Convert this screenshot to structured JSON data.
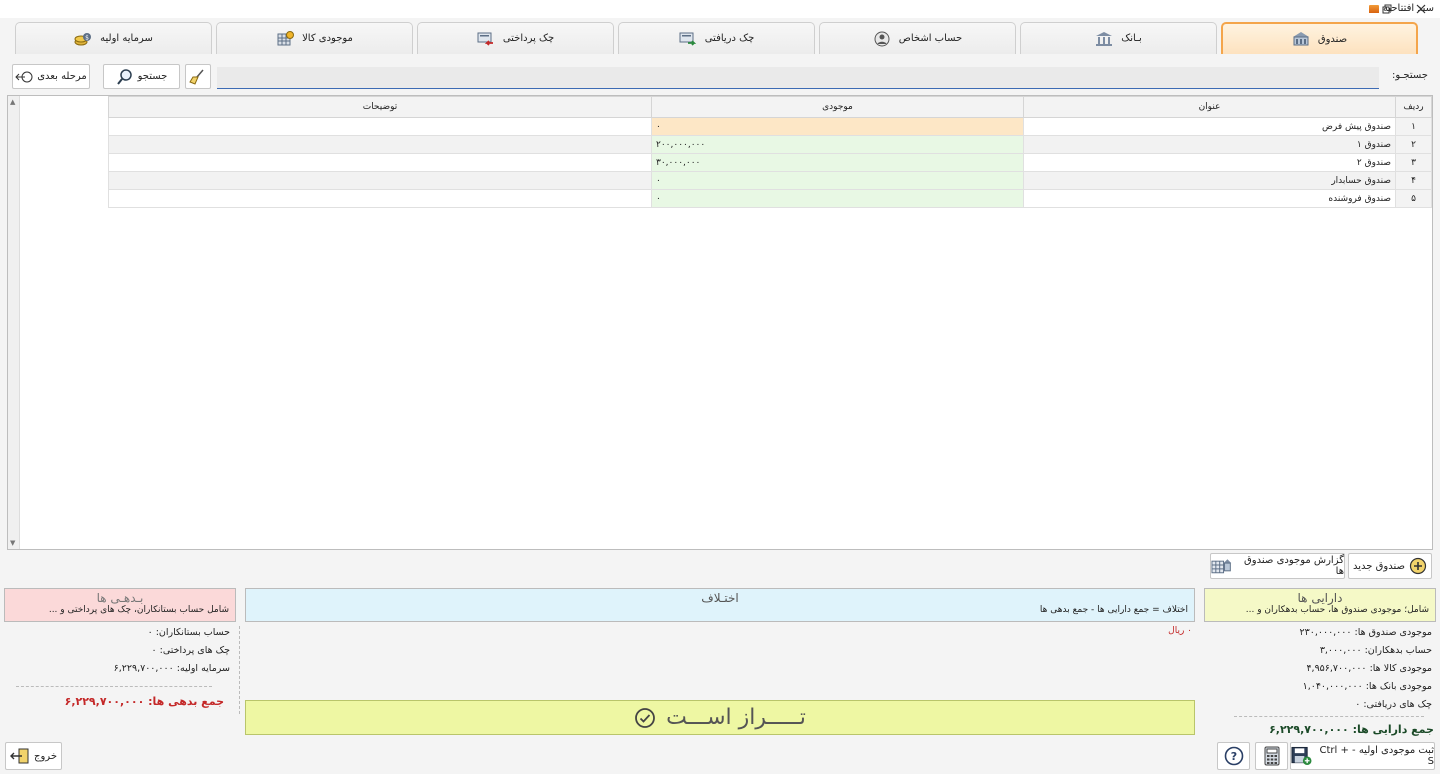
{
  "window": {
    "title": "سند افتتاحیه",
    "restore_icon": "restore-icon",
    "close_icon": "close-icon"
  },
  "tabs": [
    {
      "label": "صندوق",
      "icon": "cashbox-icon",
      "active": true
    },
    {
      "label": "بـانک",
      "icon": "bank-icon",
      "active": false
    },
    {
      "label": "حساب اشخاص",
      "icon": "person-icon",
      "active": false
    },
    {
      "label": "چک دریافتی",
      "icon": "received-check-icon",
      "active": false
    },
    {
      "label": "چک پرداختی",
      "icon": "paid-check-icon",
      "active": false
    },
    {
      "label": "موجودی کالا",
      "icon": "inventory-icon",
      "active": false
    },
    {
      "label": "سرمایه اولیه",
      "icon": "capital-icon",
      "active": false
    }
  ],
  "search": {
    "label": "جستجـو:",
    "value": "",
    "search_button": "جستجو",
    "next_button": "مرحله بعدی"
  },
  "grid": {
    "columns": [
      "ردیف",
      "عنوان",
      "موجودی",
      "توضیحات"
    ],
    "rows": [
      {
        "no": "۱",
        "title": "صندوق پیش فرض",
        "amount": "۰",
        "desc": ""
      },
      {
        "no": "۲",
        "title": "صندوق ۱",
        "amount": "۲۰۰,۰۰۰,۰۰۰",
        "desc": ""
      },
      {
        "no": "۳",
        "title": "صندوق ۲",
        "amount": "۳۰,۰۰۰,۰۰۰",
        "desc": ""
      },
      {
        "no": "۴",
        "title": "صندوق حسابدار",
        "amount": "۰",
        "desc": ""
      },
      {
        "no": "۵",
        "title": "صندوق فروشنده",
        "amount": "۰",
        "desc": ""
      }
    ]
  },
  "cash_actions": {
    "new_cashbox": "صندوق جدید",
    "cash_report": "گزارش موجودی صندوق ها"
  },
  "assets": {
    "title": "دارایی ها",
    "subtitle": "شامل؛ موجودی صندوق ها، حساب بدهکاران و ...",
    "lines": [
      "موجودی صندوق ها: ۲۳۰,۰۰۰,۰۰۰",
      "حساب بدهکاران: ۳,۰۰۰,۰۰۰",
      "موجودی کالا ها: ۴,۹۵۶,۷۰۰,۰۰۰",
      "موجودی بانک ها: ۱,۰۴۰,۰۰۰,۰۰۰",
      "چک های دریافتی: ۰"
    ],
    "total": "جمع دارایی ها: ۶,۲۲۹,۷۰۰,۰۰۰"
  },
  "difference": {
    "title": "اختـلاف",
    "subtitle": "اختلاف  =  جمع دارایی ها  -  جمع بدهی ها",
    "value": "۰ ریال",
    "balance_text": "تـــــراز اســـت",
    "balance_icon": "check-circle-icon"
  },
  "debts": {
    "title": "بـدهـی ها",
    "subtitle": "شامل حساب بستانکاران، چک های پرداختی و ...",
    "lines": [
      "حساب بستانکاران: ۰",
      "چک های پرداختی: ۰",
      "سرمایه اولیه:  ۶,۲۲۹,۷۰۰,۰۰۰"
    ],
    "total": "جمع بدهی ها: ۶,۲۲۹,۷۰۰,۰۰۰"
  },
  "footer": {
    "save_label": "ثبت موجودی اولیه - Ctrl + S",
    "exit_label": "خروج"
  },
  "colors": {
    "active_tab_border": "#f4a54b",
    "assets_bg": "#f5f9c7",
    "diff_bg": "#dff3fb",
    "debts_bg": "#fbd9d9",
    "balance_bg": "#eef7a3",
    "accent_line": "#3d6bb4"
  }
}
